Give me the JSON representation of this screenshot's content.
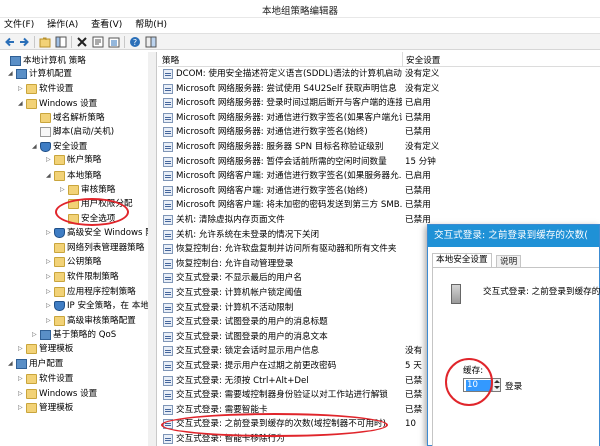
{
  "window": {
    "title": "本地组策略编辑器"
  },
  "menu": [
    "文件(F)",
    "操作(A)",
    "查看(V)",
    "帮助(H)"
  ],
  "tree": [
    {
      "label": "本地计算机 策略",
      "icon": "computer-icon",
      "toggle": ""
    },
    {
      "label": "计算机配置",
      "icon": "computer-icon",
      "toggle": "◢"
    },
    {
      "label": "软件设置",
      "icon": "folder-icon",
      "toggle": "▷"
    },
    {
      "label": "Windows 设置",
      "icon": "folder-icon",
      "toggle": "◢"
    },
    {
      "label": "域名解析策略",
      "icon": "folder-icon",
      "toggle": ""
    },
    {
      "label": "脚本(启动/关机)",
      "icon": "script-icon",
      "toggle": ""
    },
    {
      "label": "安全设置",
      "icon": "shield-icon",
      "toggle": "◢"
    },
    {
      "label": "帐户策略",
      "icon": "folder-icon",
      "toggle": "▷"
    },
    {
      "label": "本地策略",
      "icon": "folder-icon",
      "toggle": "◢"
    },
    {
      "label": "审核策略",
      "icon": "folder-icon",
      "toggle": "▷"
    },
    {
      "label": "用户权限分配",
      "icon": "folder-icon",
      "toggle": ""
    },
    {
      "label": "安全选项",
      "icon": "folder-icon",
      "toggle": ""
    },
    {
      "label": "高级安全 Windows 防",
      "icon": "shield-icon",
      "toggle": "▷"
    },
    {
      "label": "网络列表管理器策略",
      "icon": "folder-icon",
      "toggle": ""
    },
    {
      "label": "公钥策略",
      "icon": "folder-icon",
      "toggle": "▷"
    },
    {
      "label": "软件限制策略",
      "icon": "folder-icon",
      "toggle": "▷"
    },
    {
      "label": "应用程序控制策略",
      "icon": "folder-icon",
      "toggle": "▷"
    },
    {
      "label": "IP 安全策略，在 本地计",
      "icon": "shield-icon",
      "toggle": "▷"
    },
    {
      "label": "高级审核策略配置",
      "icon": "folder-icon",
      "toggle": "▷"
    },
    {
      "label": "基于策略的 QoS",
      "icon": "chart-icon",
      "toggle": "▷"
    },
    {
      "label": "管理模板",
      "icon": "folder-icon",
      "toggle": "▷"
    },
    {
      "label": "用户配置",
      "icon": "user-icon",
      "toggle": "◢"
    },
    {
      "label": "软件设置",
      "icon": "folder-icon",
      "toggle": "▷"
    },
    {
      "label": "Windows 设置",
      "icon": "folder-icon",
      "toggle": "▷"
    },
    {
      "label": "管理模板",
      "icon": "folder-icon",
      "toggle": "▷"
    }
  ],
  "columns": {
    "policy": "策略",
    "setting": "安全设置"
  },
  "policies": [
    {
      "name": "DCOM: 使用安全描述符定义语言(SDDL)语法的计算机启动...",
      "setting": "没有定义"
    },
    {
      "name": "Microsoft 网络服务器: 尝试使用 S4U2Self 获取声明信息",
      "setting": "没有定义"
    },
    {
      "name": "Microsoft 网络服务器: 登录时间过期后断开与客户端的连接",
      "setting": "已启用"
    },
    {
      "name": "Microsoft 网络服务器: 对通信进行数字签名(如果客户端允许...",
      "setting": "已禁用"
    },
    {
      "name": "Microsoft 网络服务器: 对通信进行数字签名(始终)",
      "setting": "已禁用"
    },
    {
      "name": "Microsoft 网络服务器: 服务器 SPN 目标名称验证级别",
      "setting": "没有定义"
    },
    {
      "name": "Microsoft 网络服务器: 暂停会话前所需的空闲时间数量",
      "setting": "15 分钟"
    },
    {
      "name": "Microsoft 网络客户端: 对通信进行数字签名(如果服务器允...",
      "setting": "已启用"
    },
    {
      "name": "Microsoft 网络客户端: 对通信进行数字签名(始终)",
      "setting": "已禁用"
    },
    {
      "name": "Microsoft 网络客户端: 将未加密的密码发送到第三方 SMB...",
      "setting": "已禁用"
    },
    {
      "name": "关机: 清除虚拟内存页面文件",
      "setting": "已禁用"
    },
    {
      "name": "关机: 允许系统在未登录的情况下关闭",
      "setting": ""
    },
    {
      "name": "恢复控制台: 允许软盘复制并访问所有驱动器和所有文件夹",
      "setting": ""
    },
    {
      "name": "恢复控制台: 允许自动管理登录",
      "setting": ""
    },
    {
      "name": "交互式登录: 不显示最后的用户名",
      "setting": ""
    },
    {
      "name": "交互式登录: 计算机帐户锁定阈值",
      "setting": ""
    },
    {
      "name": "交互式登录: 计算机不活动限制",
      "setting": ""
    },
    {
      "name": "交互式登录: 试图登录的用户的消息标题",
      "setting": ""
    },
    {
      "name": "交互式登录: 试图登录的用户的消息文本",
      "setting": ""
    },
    {
      "name": "交互式登录: 锁定会话时显示用户信息",
      "setting": "没有"
    },
    {
      "name": "交互式登录: 提示用户在过期之前更改密码",
      "setting": "5 天"
    },
    {
      "name": "交互式登录: 无须按 Ctrl+Alt+Del",
      "setting": "已禁"
    },
    {
      "name": "交互式登录: 需要域控制器身份验证以对工作站进行解锁",
      "setting": "已禁"
    },
    {
      "name": "交互式登录: 需要智能卡",
      "setting": "已禁"
    },
    {
      "name": "交互式登录: 之前登录到缓存的次数(域控制器不可用时)",
      "setting": "10"
    },
    {
      "name": "交互式登录: 智能卡移除行为",
      "setting": ""
    }
  ],
  "dialog": {
    "title": "交互式登录: 之前登录到缓存的次数(",
    "tabs": [
      "本地安全设置",
      "说明"
    ],
    "description": "交互式登录: 之前登录到缓存的次数(",
    "cache_label": "缓存:",
    "cache_value": "10",
    "unit": "登录"
  },
  "colors": {
    "accent": "#1f91d6",
    "highlight": "#e0252b",
    "selection": "#3399ff"
  }
}
